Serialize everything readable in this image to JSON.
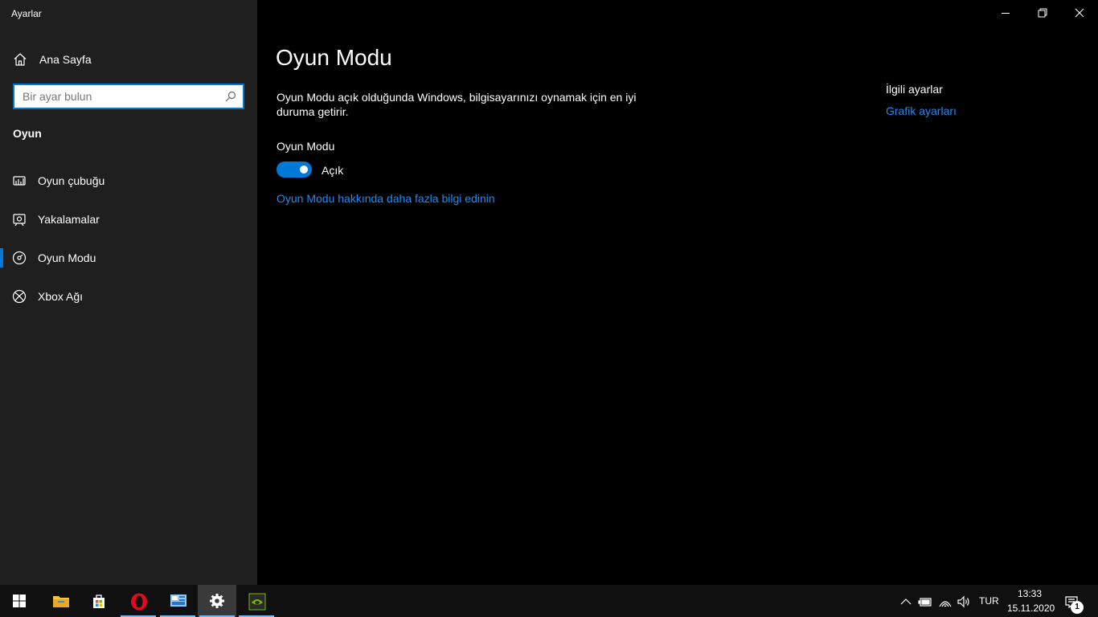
{
  "window": {
    "title": "Ayarlar"
  },
  "sidebar": {
    "home_label": "Ana Sayfa",
    "search_placeholder": "Bir ayar bulun",
    "section_title": "Oyun",
    "items": [
      {
        "label": "Oyun çubuğu",
        "icon": "game-bar-icon",
        "active": false
      },
      {
        "label": "Yakalamalar",
        "icon": "captures-icon",
        "active": false
      },
      {
        "label": "Oyun Modu",
        "icon": "game-mode-icon",
        "active": true
      },
      {
        "label": "Xbox Ağı",
        "icon": "xbox-icon",
        "active": false
      }
    ]
  },
  "main": {
    "title": "Oyun Modu",
    "description": "Oyun Modu açık olduğunda Windows, bilgisayarınızı oynamak için en iyi duruma getirir.",
    "toggle_label": "Oyun Modu",
    "toggle_on": true,
    "toggle_state": "Açık",
    "learn_more": "Oyun Modu hakkında daha fazla bilgi edinin"
  },
  "related": {
    "title": "İlgili ayarlar",
    "link": "Grafik ayarları"
  },
  "taskbar": {
    "apps": [
      "start-icon",
      "file-explorer-icon",
      "store-icon",
      "opera-icon",
      "control-panel-icon",
      "settings-icon",
      "nvidia-icon"
    ],
    "language": "TUR",
    "time": "13:33",
    "date": "15.11.2020",
    "notification_count": "1"
  },
  "colors": {
    "accent": "#0078d7",
    "link": "#1a8cff",
    "sidebar_bg": "#1f1f1f",
    "main_bg": "#000000",
    "taskbar_bg": "#101010"
  }
}
